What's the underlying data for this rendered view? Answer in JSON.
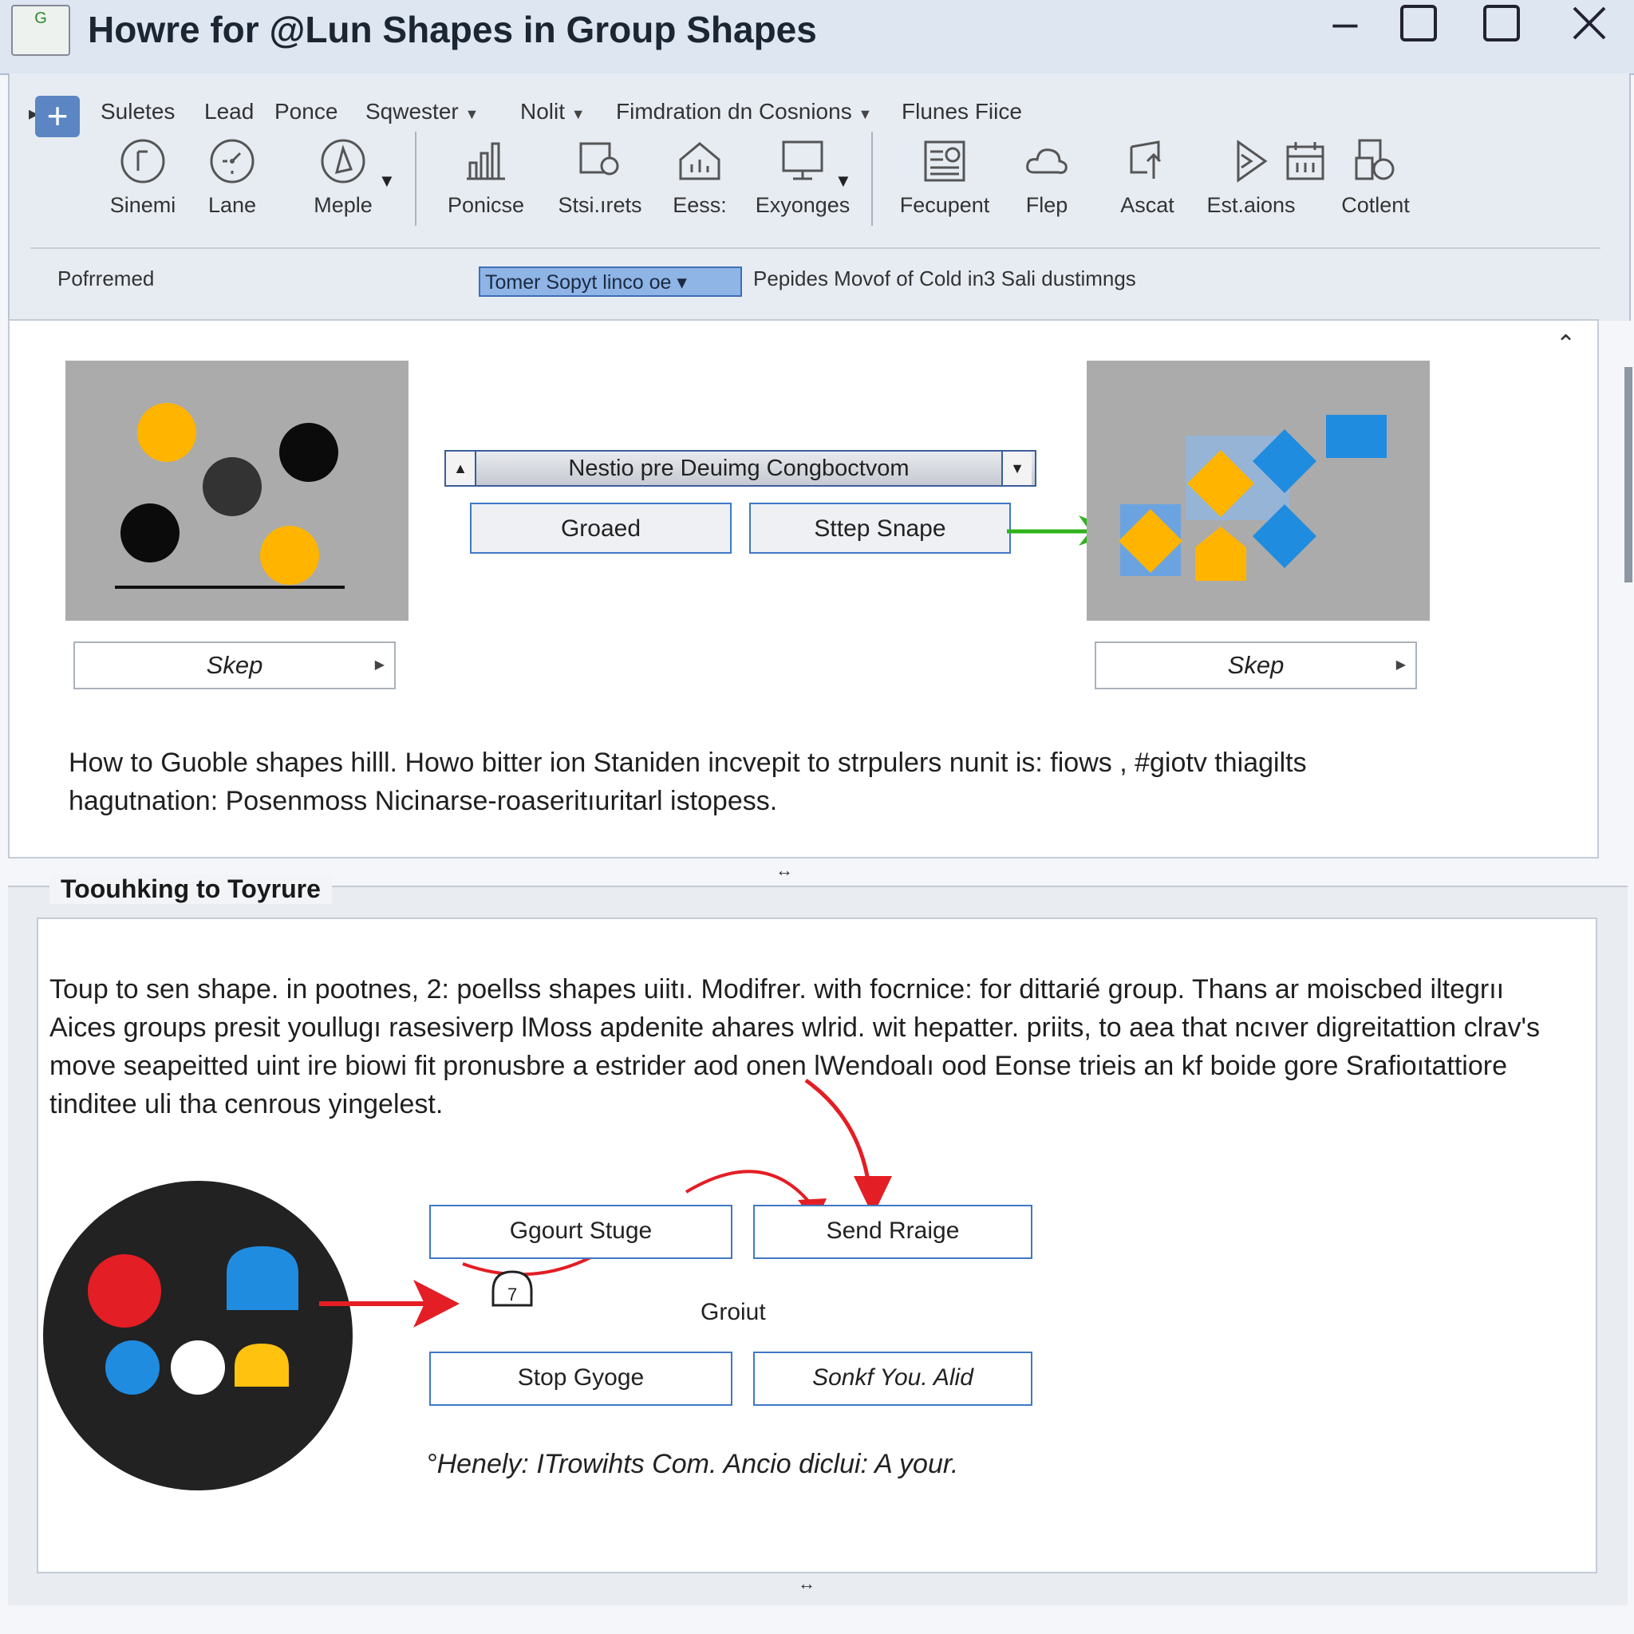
{
  "window": {
    "title": "Howre for @Lun Shapes in Group Shapes",
    "app_icon_text": "G"
  },
  "menu": [
    {
      "label": "Suletes",
      "has_dropdown": false
    },
    {
      "label": "Lead",
      "has_dropdown": false
    },
    {
      "label": "Ponce",
      "has_dropdown": false
    },
    {
      "label": "Sqwester",
      "has_dropdown": true
    },
    {
      "label": "Nolit",
      "has_dropdown": true
    },
    {
      "label": "Fimdration dn Cosnions",
      "has_dropdown": true
    },
    {
      "label": "Flunes Fiice",
      "has_dropdown": false
    }
  ],
  "ribbon": [
    {
      "label": "Sinemi",
      "icon": "circle-icon"
    },
    {
      "label": "Lane",
      "icon": "dial-icon"
    },
    {
      "label": "Meple",
      "icon": "compass-icon"
    },
    {
      "label": "Ponicse",
      "icon": "bar-chart-icon"
    },
    {
      "label": "Stsi.ırets",
      "icon": "shape-edit-icon"
    },
    {
      "label": "Eess:",
      "icon": "home-chart-icon"
    },
    {
      "label": "Exyonges",
      "icon": "monitor-icon"
    },
    {
      "label": "Fecupent",
      "icon": "document-image-icon"
    },
    {
      "label": "Flep",
      "icon": "cloud-icon"
    },
    {
      "label": "Ascat",
      "icon": "arrange-icon"
    },
    {
      "label": "Est.aions",
      "icon": "play-shape-icon"
    },
    {
      "label": "",
      "icon": "calendar-grid-icon"
    },
    {
      "label": "Cotlent",
      "icon": "group-objects-icon"
    }
  ],
  "status_bar": {
    "left_label": "Pofrremed",
    "selector_value": "Tomer Sopyt linco oe ▾",
    "text": "Pepides Movof of Cold in3 Sali dustimngs"
  },
  "top_panel": {
    "combo_value": "Nestio pre Deuimg Congboctvom",
    "button_left": "Groaed",
    "button_right": "Sttep Snape",
    "step_left": "Skep",
    "step_right": "Skep",
    "description": "How to Guoble shapes hilll. Howo bitter ion Staniden incvepit to strpulers nunit is: fiows , #giotv thiagilts hagutnation: Posenmoss Nicinarse-roaseritıuritarl istopess."
  },
  "bottom_panel": {
    "group_title": "Toouhking to Toyrure",
    "description": "Toup to sen shape. in pootnes, 2: poellss shapes uiitı. Modifrer. with focrnice: for dittarié group. Thans ar moiscbed iltegrıı Aices groups presit youllugı rasesiverp lMoss apdenite ahares wlrid. wit hepatter. priits, to aea that ncıver digreitattion clrav's move seapeitted uint ire biowi fit pronusbre a estrider aod onen lWendoalı ood Eonse trieis an kf boide gore Srafioıtattiore tinditee uli tha cenrous yingelest.",
    "buttons": [
      "Ggourt Stuge",
      "Send Rraige",
      "Stop Gyoge",
      "Sonkf You. Alid"
    ],
    "center_label": "Groiut",
    "cursor_hint": "7",
    "footer": "°Henely: ITrowihts Com. Ancio diclui: A your."
  },
  "colors": {
    "accent_blue": "#1f8ce0",
    "yellow": "#ffb400",
    "red": "#e31e24",
    "green": "#2fb31c",
    "dark": "#222222"
  }
}
